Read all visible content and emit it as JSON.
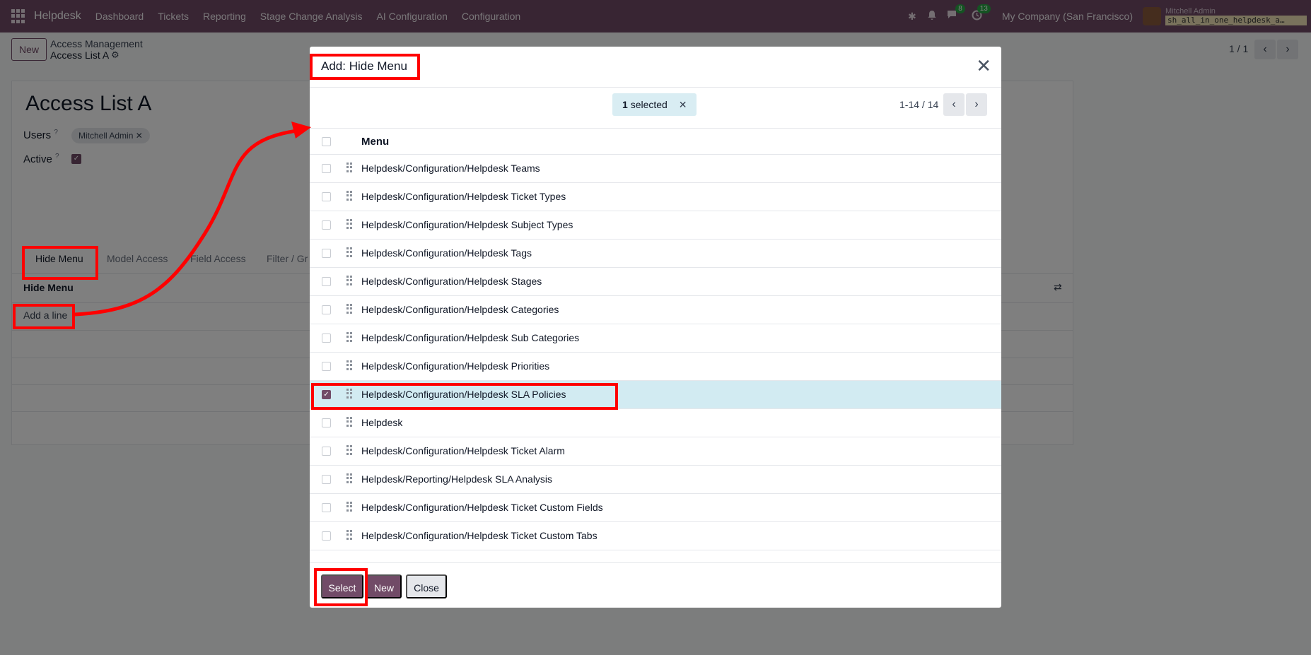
{
  "topnav": {
    "brand": "Helpdesk",
    "menu": [
      "Dashboard",
      "Tickets",
      "Reporting",
      "Stage Change Analysis",
      "AI Configuration",
      "Configuration"
    ],
    "chat_badge": "8",
    "activity_badge": "13",
    "company": "My Company (San Francisco)",
    "user_name": "Mitchell Admin",
    "db_name": "sh_all_in_one_helpdesk_a…"
  },
  "control_panel": {
    "new_label": "New",
    "breadcrumb_parent": "Access Management",
    "breadcrumb_current": "Access List A",
    "pager": "1 / 1"
  },
  "form": {
    "title": "Access List A",
    "users_label": "Users",
    "active_label": "Active",
    "help_mark": "?",
    "user_tag": "Mitchell Admin",
    "tabs": [
      "Hide Menu",
      "Model Access",
      "Field Access",
      "Filter / Gr"
    ],
    "list_header": "Hide Menu",
    "add_line": "Add a line"
  },
  "modal": {
    "title": "Add: Hide Menu",
    "selected_count": "1",
    "selected_text": "selected",
    "pager": "1-14 / 14",
    "column_header": "Menu",
    "rows": [
      {
        "label": "Helpdesk/Configuration/Helpdesk Teams",
        "checked": false
      },
      {
        "label": "Helpdesk/Configuration/Helpdesk Ticket Types",
        "checked": false
      },
      {
        "label": "Helpdesk/Configuration/Helpdesk Subject Types",
        "checked": false
      },
      {
        "label": "Helpdesk/Configuration/Helpdesk Tags",
        "checked": false
      },
      {
        "label": "Helpdesk/Configuration/Helpdesk Stages",
        "checked": false
      },
      {
        "label": "Helpdesk/Configuration/Helpdesk Categories",
        "checked": false
      },
      {
        "label": "Helpdesk/Configuration/Helpdesk Sub Categories",
        "checked": false
      },
      {
        "label": "Helpdesk/Configuration/Helpdesk Priorities",
        "checked": false
      },
      {
        "label": "Helpdesk/Configuration/Helpdesk SLA Policies",
        "checked": true
      },
      {
        "label": "Helpdesk",
        "checked": false
      },
      {
        "label": "Helpdesk/Configuration/Helpdesk Ticket Alarm",
        "checked": false
      },
      {
        "label": "Helpdesk/Reporting/Helpdesk SLA Analysis",
        "checked": false
      },
      {
        "label": "Helpdesk/Configuration/Helpdesk Ticket Custom Fields",
        "checked": false
      },
      {
        "label": "Helpdesk/Configuration/Helpdesk Ticket Custom Tabs",
        "checked": false
      }
    ],
    "footer": {
      "select": "Select",
      "new": "New",
      "close": "Close"
    }
  },
  "colors": {
    "brand": "#714b67",
    "highlight": "#ff0000",
    "selected_row": "#d2ebf2"
  }
}
